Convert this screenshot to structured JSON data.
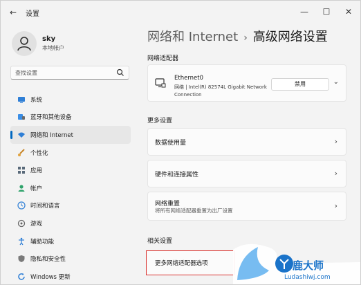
{
  "window": {
    "title": "设置"
  },
  "user": {
    "name": "sky",
    "type": "本地帐户"
  },
  "search": {
    "placeholder": "查找设置"
  },
  "sidebar": {
    "items": [
      {
        "label": "系统",
        "icon": "monitor-icon"
      },
      {
        "label": "蓝牙和其他设备",
        "icon": "bluetooth-icon"
      },
      {
        "label": "网络和 Internet",
        "icon": "wifi-icon",
        "active": true
      },
      {
        "label": "个性化",
        "icon": "brush-icon"
      },
      {
        "label": "应用",
        "icon": "apps-icon"
      },
      {
        "label": "帐户",
        "icon": "person-icon"
      },
      {
        "label": "时间和语言",
        "icon": "globe-clock-icon"
      },
      {
        "label": "游戏",
        "icon": "gamepad-icon"
      },
      {
        "label": "辅助功能",
        "icon": "accessibility-icon"
      },
      {
        "label": "隐私和安全性",
        "icon": "shield-icon"
      },
      {
        "label": "Windows 更新",
        "icon": "update-icon"
      }
    ]
  },
  "breadcrumb": {
    "parent": "网络和 Internet",
    "separator": "›",
    "current": "高级网络设置"
  },
  "adapters": {
    "heading": "网络适配器",
    "name": "Ethernet0",
    "description": "网络 | Intel(R) 82574L Gigabit Network Connection",
    "disable_label": "禁用"
  },
  "more": {
    "heading": "更多设置",
    "items": [
      {
        "label": "数据使用量"
      },
      {
        "label": "硬件和连接属性"
      },
      {
        "label": "网络重置",
        "sub": "将所有网络适配器重置为出厂设置"
      }
    ]
  },
  "related": {
    "heading": "相关设置",
    "item_label": "更多网络适配器选项"
  },
  "watermark": {
    "text": "鹿大师",
    "url": "Ludashiwj.com"
  },
  "colors": {
    "accent": "#0067c0",
    "highlight": "#d9302c",
    "watermark": "#1a73c9"
  }
}
